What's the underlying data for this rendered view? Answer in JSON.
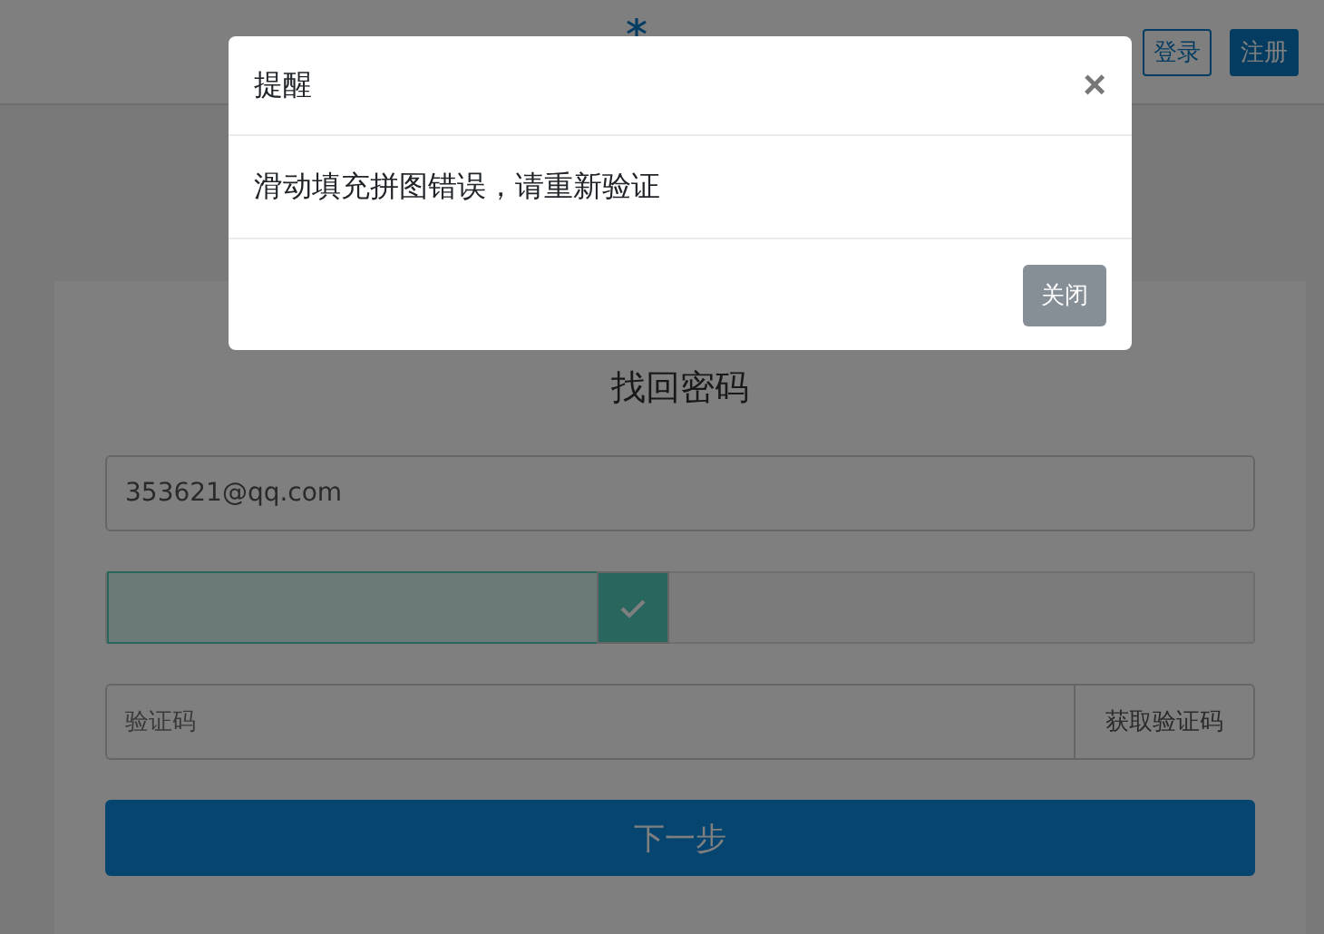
{
  "header": {
    "buttons": [
      {
        "label": "登录",
        "kind": "outline"
      },
      {
        "label": "注册",
        "kind": "solid"
      }
    ]
  },
  "form": {
    "title": "找回密码",
    "email": {
      "value": "353621@qq.com"
    },
    "slider": {
      "level": 0.49,
      "verified": true
    },
    "code": {
      "placeholder": "验证码",
      "button": "获取验证码"
    },
    "submit": "下一步"
  },
  "modal": {
    "title": "提醒",
    "close": "×",
    "message": "滑动填充拼图错误，请重新验证",
    "button": "关闭"
  }
}
